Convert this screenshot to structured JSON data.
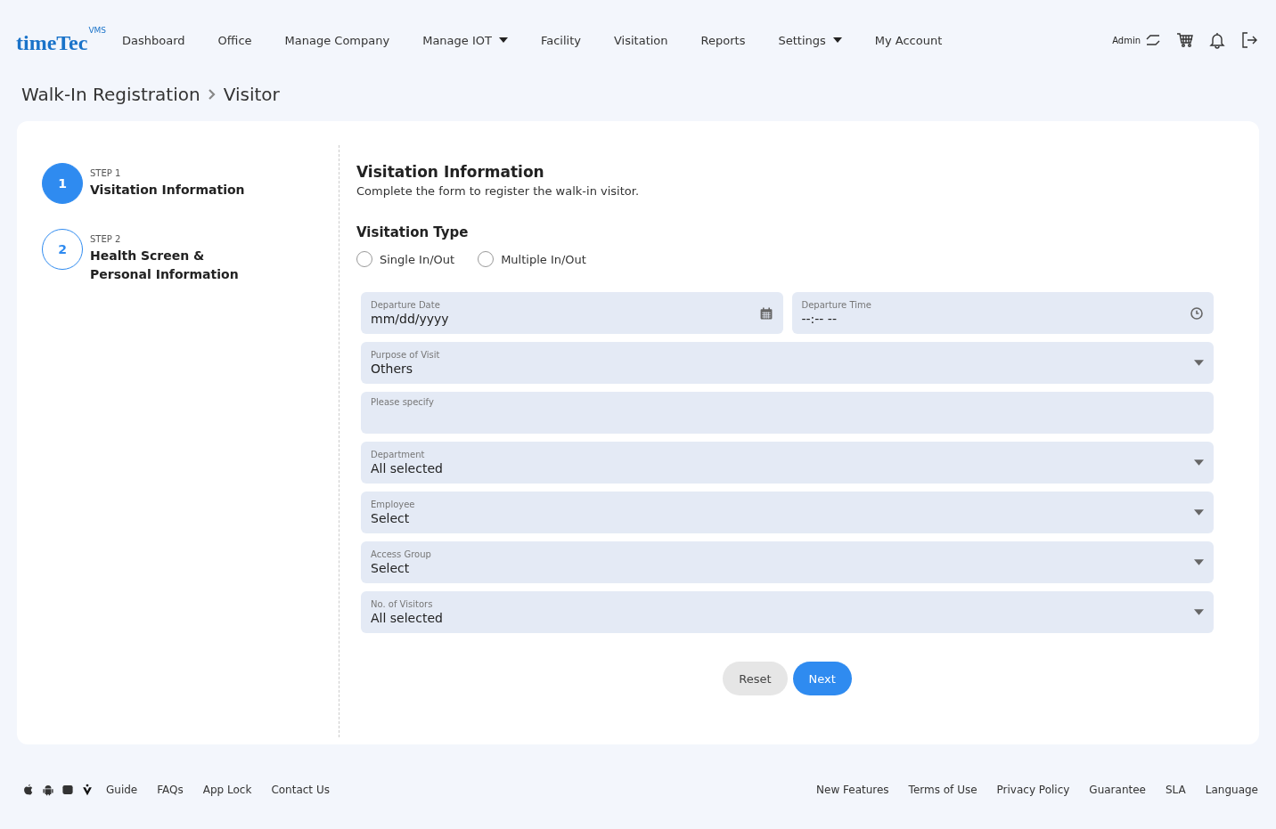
{
  "logo": {
    "word": "timeTec",
    "badge": "VMS"
  },
  "nav": [
    {
      "label": "Dashboard",
      "has_menu": false
    },
    {
      "label": "Office",
      "has_menu": false
    },
    {
      "label": "Manage Company",
      "has_menu": false
    },
    {
      "label": "Manage IOT",
      "has_menu": true
    },
    {
      "label": "Facility",
      "has_menu": false
    },
    {
      "label": "Visitation",
      "has_menu": false
    },
    {
      "label": "Reports",
      "has_menu": false
    },
    {
      "label": "Settings",
      "has_menu": true
    },
    {
      "label": "My Account",
      "has_menu": false
    }
  ],
  "user": {
    "name": "Admin"
  },
  "breadcrumb": [
    "Walk-In Registration",
    "Visitor"
  ],
  "steps": [
    {
      "number": "1",
      "step": "STEP 1",
      "title": "Visitation Information",
      "selected": true
    },
    {
      "number": "2",
      "step": "STEP 2",
      "title": "Health Screen & Personal Information",
      "selected": false
    }
  ],
  "form": {
    "title": "Visitation Information",
    "subtitle": "Complete the form to register the walk-in visitor.",
    "type_heading": "Visitation Type",
    "visitation_types": [
      {
        "label": "Single In/Out",
        "selected": false
      },
      {
        "label": "Multiple In/Out",
        "selected": false
      }
    ],
    "rows": [
      [
        {
          "kind": "date",
          "label": "Departure Date",
          "value": "mm/dd/yyyy"
        },
        {
          "kind": "time",
          "label": "Departure Time",
          "value": "--:-- --"
        }
      ],
      [
        {
          "kind": "select",
          "label": "Purpose of Visit",
          "value": "Others"
        }
      ],
      [
        {
          "kind": "text",
          "placeholder": "Please specify"
        }
      ],
      [
        {
          "kind": "select",
          "label": "Department",
          "value": "All selected"
        }
      ],
      [
        {
          "kind": "select",
          "label": "Employee",
          "value": "Select"
        }
      ],
      [
        {
          "kind": "select",
          "label": "Access Group",
          "value": "Select"
        }
      ],
      [
        {
          "kind": "select",
          "label": "No. of Visitors",
          "value": "All selected"
        }
      ]
    ],
    "buttons": [
      {
        "label": "Reset",
        "kind": "secondary"
      },
      {
        "label": "Next",
        "kind": "primary"
      }
    ]
  },
  "footer": {
    "left": [
      "Guide",
      "FAQs",
      "App Lock",
      "Contact Us"
    ],
    "right": [
      "New Features",
      "Terms of Use",
      "Privacy Policy",
      "Guarantee",
      "SLA",
      "Language"
    ]
  }
}
